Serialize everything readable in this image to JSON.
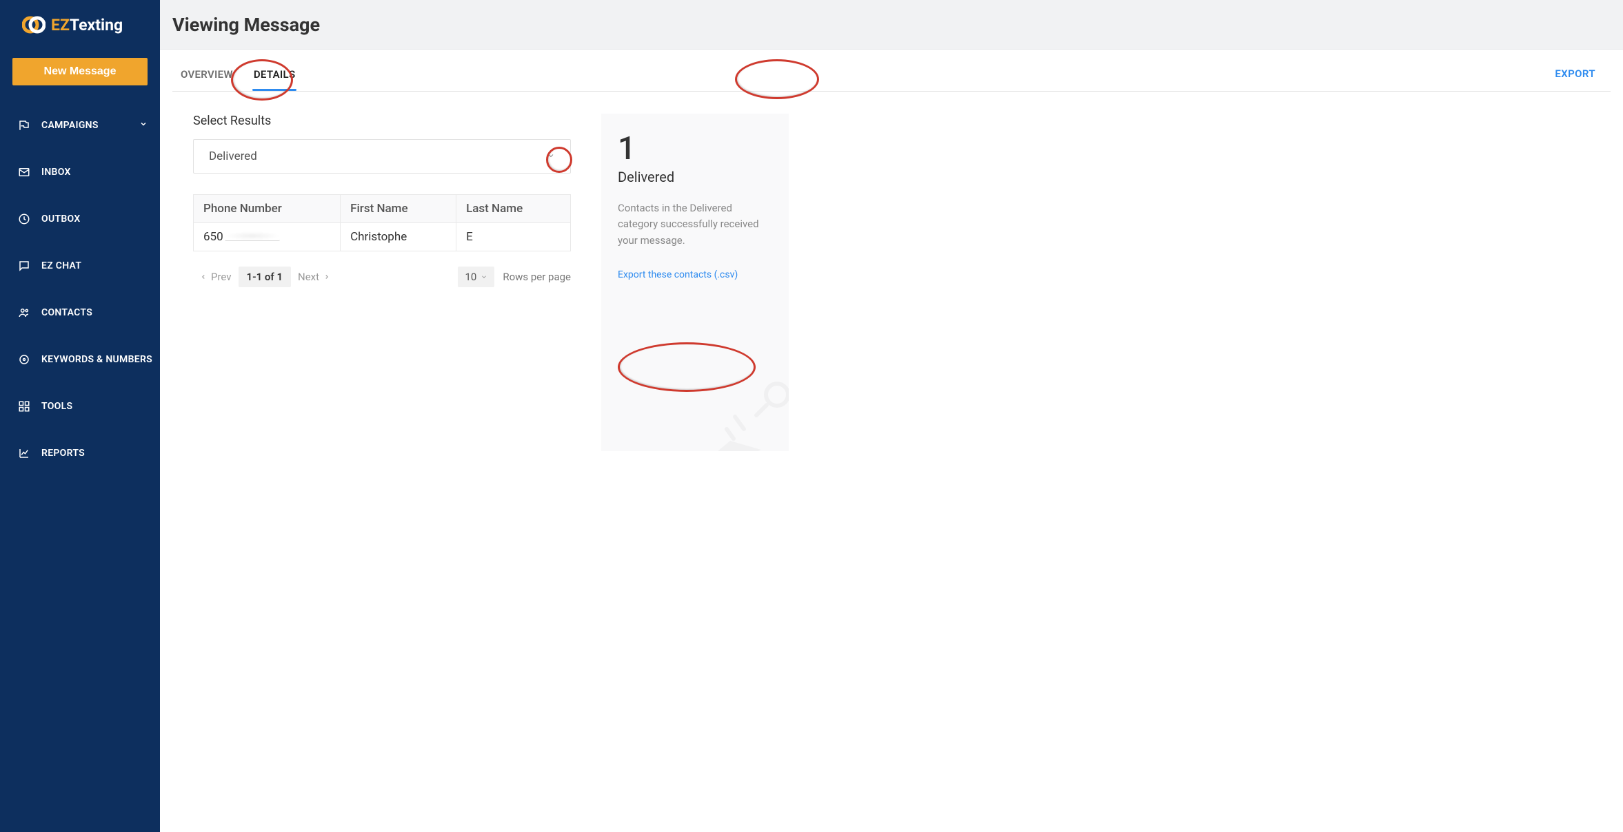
{
  "brand": {
    "name1": "EZ",
    "name2": "Texting"
  },
  "sidebar": {
    "new_message": "New Message",
    "items": [
      {
        "label": "CAMPAIGNS",
        "expandable": true
      },
      {
        "label": "INBOX"
      },
      {
        "label": "OUTBOX"
      },
      {
        "label": "EZ CHAT"
      },
      {
        "label": "CONTACTS"
      },
      {
        "label": "KEYWORDS & NUMBERS"
      },
      {
        "label": "TOOLS"
      },
      {
        "label": "REPORTS"
      }
    ]
  },
  "header": {
    "title": "Viewing Message"
  },
  "tabs": {
    "overview": "OVERVIEW",
    "details": "DETAILS",
    "export": "EXPORT"
  },
  "filter": {
    "label": "Select Results",
    "selected": "Delivered"
  },
  "table": {
    "columns": {
      "phone": "Phone Number",
      "first": "First Name",
      "last": "Last Name"
    },
    "rows": [
      {
        "phone_prefix": "650",
        "first": "Christophe",
        "last": "E"
      }
    ]
  },
  "pager": {
    "prev": "Prev",
    "range": "1-1 of 1",
    "next": "Next",
    "rows_value": "10",
    "rows_label": "Rows per page"
  },
  "card": {
    "count": "1",
    "title": "Delivered",
    "description": "Contacts in the Delivered category successfully received your message.",
    "export_link": "Export these contacts (.csv)"
  }
}
